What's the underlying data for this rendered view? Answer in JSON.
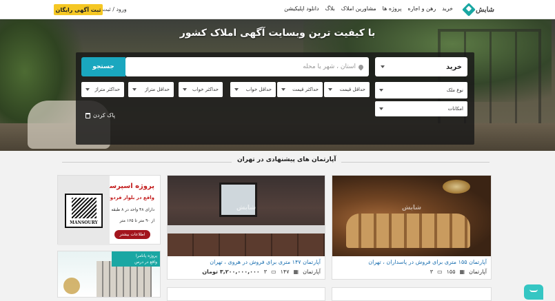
{
  "header": {
    "brand": "شابش",
    "nav": [
      "خرید",
      "رهن و اجاره",
      "پروژه ها",
      "مشاورین املاک",
      "بلاگ",
      "دانلود اپلیکیشن"
    ],
    "login": "ورود / ثبت نام",
    "post_ad": "ثبت آگهی رایگان",
    "accent": "#1aa7a3",
    "post_ad_color": "#f5c724"
  },
  "hero": {
    "title": "با کیفیت ترین وبسایت آگهی املاک کشور",
    "deal_type": "خرید",
    "location_placeholder": "استان ، شهر یا محله",
    "search_button": "جستجو",
    "filters_row1": [
      "نوع ملک",
      "حداقل قیمت",
      "حداکثر قیمت",
      "حداقل خواب",
      "حداکثر خواب",
      "حداقل متراژ",
      "حداکثر متراژ"
    ],
    "filters_row2": [
      "امکانات"
    ],
    "clear": "پاک کردن"
  },
  "section": {
    "title": "آپارتمان های پیشنهادی در تهران"
  },
  "listings": [
    {
      "title": "آپارتمان ۱۵۵ متری برای فروش در پاسداران ، تهران",
      "type": "آپارتمان",
      "area": "۱۵۵",
      "rooms": "۳",
      "price": ""
    },
    {
      "title": "آپارتمان ۱۴۷ متری برای فروش در هروی ، تهران",
      "type": "آپارتمان",
      "area": "۱۴۷",
      "rooms": "۳",
      "price": "۳,۲۰۰,۰۰۰,۰۰۰ تومان"
    }
  ],
  "watermark": "شابش",
  "ads": {
    "ad1": {
      "title": "پروژه اسپرسا",
      "subtitle": "واقع در بلوار فردوس",
      "line1": "دارای ۴۸ واحد در ۸ طبقه",
      "line2": "از ۹۰ متر تا ۱۶۵ متر",
      "more": "اطلاعات بیشتر",
      "logo_text": "MANSOURY"
    },
    "ad2": {
      "title": "پروژه پانامرا",
      "subtitle": "واقع در درس"
    }
  },
  "icons": {
    "logo": "diamond-logo-icon",
    "caret": "chevron-down-icon",
    "location": "map-pin-icon",
    "trash": "trash-icon",
    "area": "area-icon",
    "bed": "bed-icon",
    "chat": "chat-icon"
  }
}
